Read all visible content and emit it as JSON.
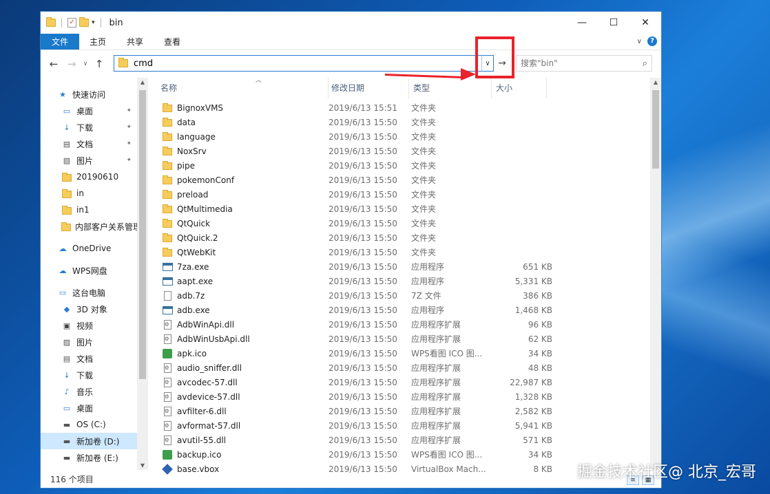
{
  "window": {
    "title": "bin"
  },
  "ribbon": {
    "tabs": [
      "文件",
      "主页",
      "共享",
      "查看"
    ]
  },
  "address": {
    "value": "cmd"
  },
  "search": {
    "placeholder": "搜索\"bin\""
  },
  "columns": {
    "name": "名称",
    "date": "修改日期",
    "type": "类型",
    "size": "大小"
  },
  "nav": [
    {
      "label": "快速访问",
      "icon": "star-icon",
      "level": 0
    },
    {
      "label": "桌面",
      "icon": "desktop-icon",
      "level": 1,
      "pinned": true
    },
    {
      "label": "下载",
      "icon": "download-icon",
      "level": 1,
      "pinned": true
    },
    {
      "label": "文档",
      "icon": "document-icon",
      "level": 1,
      "pinned": true
    },
    {
      "label": "图片",
      "icon": "pictures-icon",
      "level": 1,
      "pinned": true
    },
    {
      "label": "20190610",
      "icon": "folder-icon",
      "level": 1
    },
    {
      "label": "in",
      "icon": "folder-icon",
      "level": 1
    },
    {
      "label": "in1",
      "icon": "folder-icon",
      "level": 1
    },
    {
      "label": "内部客户关系管理",
      "icon": "folder-icon",
      "level": 1
    },
    {
      "label": "OneDrive",
      "icon": "cloud-icon",
      "level": 0
    },
    {
      "label": "WPS网盘",
      "icon": "cloud-icon",
      "level": 0
    },
    {
      "label": "这台电脑",
      "icon": "computer-icon",
      "level": 0
    },
    {
      "label": "3D 对象",
      "icon": "cube-icon",
      "level": 1
    },
    {
      "label": "视频",
      "icon": "video-icon",
      "level": 1
    },
    {
      "label": "图片",
      "icon": "pictures-icon",
      "level": 1
    },
    {
      "label": "文档",
      "icon": "document-icon",
      "level": 1
    },
    {
      "label": "下载",
      "icon": "download-icon",
      "level": 1
    },
    {
      "label": "音乐",
      "icon": "music-icon",
      "level": 1
    },
    {
      "label": "桌面",
      "icon": "desktop-icon",
      "level": 1
    },
    {
      "label": "OS (C:)",
      "icon": "drive-icon",
      "level": 1
    },
    {
      "label": "新加卷 (D:)",
      "icon": "drive-icon",
      "level": 1,
      "selected": true
    },
    {
      "label": "新加卷 (E:)",
      "icon": "drive-icon",
      "level": 1
    }
  ],
  "files": [
    {
      "name": "BignoxVMS",
      "date": "2019/6/13 15:51",
      "type": "文件夹",
      "size": "",
      "icon": "folder"
    },
    {
      "name": "data",
      "date": "2019/6/13 15:50",
      "type": "文件夹",
      "size": "",
      "icon": "folder"
    },
    {
      "name": "language",
      "date": "2019/6/13 15:50",
      "type": "文件夹",
      "size": "",
      "icon": "folder"
    },
    {
      "name": "NoxSrv",
      "date": "2019/6/13 15:50",
      "type": "文件夹",
      "size": "",
      "icon": "folder"
    },
    {
      "name": "pipe",
      "date": "2019/6/13 15:50",
      "type": "文件夹",
      "size": "",
      "icon": "folder"
    },
    {
      "name": "pokemonConf",
      "date": "2019/6/13 15:50",
      "type": "文件夹",
      "size": "",
      "icon": "folder"
    },
    {
      "name": "preload",
      "date": "2019/6/13 15:50",
      "type": "文件夹",
      "size": "",
      "icon": "folder"
    },
    {
      "name": "QtMultimedia",
      "date": "2019/6/13 15:50",
      "type": "文件夹",
      "size": "",
      "icon": "folder"
    },
    {
      "name": "QtQuick",
      "date": "2019/6/13 15:50",
      "type": "文件夹",
      "size": "",
      "icon": "folder"
    },
    {
      "name": "QtQuick.2",
      "date": "2019/6/13 15:50",
      "type": "文件夹",
      "size": "",
      "icon": "folder"
    },
    {
      "name": "QtWebKit",
      "date": "2019/6/13 15:50",
      "type": "文件夹",
      "size": "",
      "icon": "folder"
    },
    {
      "name": "7za.exe",
      "date": "2019/6/13 15:50",
      "type": "应用程序",
      "size": "651 KB",
      "icon": "exe"
    },
    {
      "name": "aapt.exe",
      "date": "2019/6/13 15:50",
      "type": "应用程序",
      "size": "5,331 KB",
      "icon": "exe"
    },
    {
      "name": "adb.7z",
      "date": "2019/6/13 15:50",
      "type": "7Z 文件",
      "size": "386 KB",
      "icon": "doc"
    },
    {
      "name": "adb.exe",
      "date": "2019/6/13 15:50",
      "type": "应用程序",
      "size": "1,468 KB",
      "icon": "exe"
    },
    {
      "name": "AdbWinApi.dll",
      "date": "2019/6/13 15:50",
      "type": "应用程序扩展",
      "size": "96 KB",
      "icon": "dll"
    },
    {
      "name": "AdbWinUsbApi.dll",
      "date": "2019/6/13 15:50",
      "type": "应用程序扩展",
      "size": "62 KB",
      "icon": "dll"
    },
    {
      "name": "apk.ico",
      "date": "2019/6/13 15:50",
      "type": "WPS看图 ICO 图...",
      "size": "34 KB",
      "icon": "img"
    },
    {
      "name": "audio_sniffer.dll",
      "date": "2019/6/13 15:50",
      "type": "应用程序扩展",
      "size": "48 KB",
      "icon": "dll"
    },
    {
      "name": "avcodec-57.dll",
      "date": "2019/6/13 15:50",
      "type": "应用程序扩展",
      "size": "22,987 KB",
      "icon": "dll"
    },
    {
      "name": "avdevice-57.dll",
      "date": "2019/6/13 15:50",
      "type": "应用程序扩展",
      "size": "1,328 KB",
      "icon": "dll"
    },
    {
      "name": "avfilter-6.dll",
      "date": "2019/6/13 15:50",
      "type": "应用程序扩展",
      "size": "2,582 KB",
      "icon": "dll"
    },
    {
      "name": "avformat-57.dll",
      "date": "2019/6/13 15:50",
      "type": "应用程序扩展",
      "size": "5,941 KB",
      "icon": "dll"
    },
    {
      "name": "avutil-55.dll",
      "date": "2019/6/13 15:50",
      "type": "应用程序扩展",
      "size": "571 KB",
      "icon": "dll"
    },
    {
      "name": "backup.ico",
      "date": "2019/6/13 15:50",
      "type": "WPS看图 ICO 图...",
      "size": "34 KB",
      "icon": "img"
    },
    {
      "name": "base.vbox",
      "date": "2019/6/13 15:50",
      "type": "VirtualBox Mach...",
      "size": "8 KB",
      "icon": "vbox"
    }
  ],
  "status": {
    "count": "116 个项目"
  },
  "watermark": "掘金技术社区@ 北京_宏哥"
}
